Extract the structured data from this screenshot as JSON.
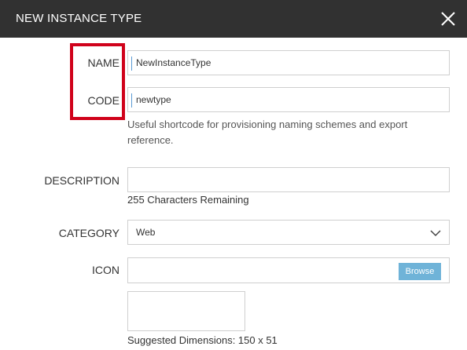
{
  "dialog": {
    "title": "NEW INSTANCE TYPE"
  },
  "form": {
    "name": {
      "label": "NAME",
      "value": "NewInstanceType"
    },
    "code": {
      "label": "CODE",
      "value": "newtype",
      "help_line1": "Useful shortcode for provisioning naming schemes and export",
      "help_line2": "reference."
    },
    "description": {
      "label": "DESCRIPTION",
      "value": "",
      "remaining": "255 Characters Remaining"
    },
    "category": {
      "label": "CATEGORY",
      "selected": "Web"
    },
    "icon": {
      "label": "ICON",
      "browse_label": "Browse",
      "dimensions_hint": "Suggested Dimensions: 150 x 51"
    }
  },
  "colors": {
    "titlebar": "#313131",
    "highlight": "#d0021b",
    "browse_button": "#6fb3d8"
  }
}
